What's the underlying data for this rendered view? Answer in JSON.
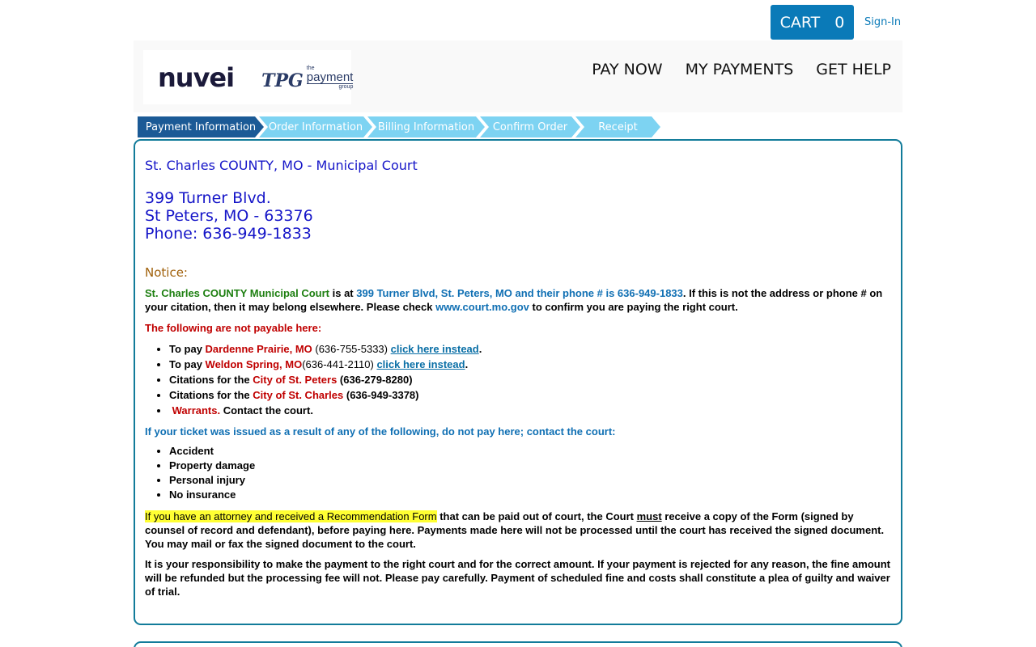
{
  "topbar": {
    "cart_label": "CART",
    "cart_count": "0",
    "signin_label": "Sign-In"
  },
  "header": {
    "logo_nuvei": "nuvei",
    "logo_tpg_mark": "TPG",
    "logo_tpg_small": "the",
    "logo_tpg_big": "payment",
    "logo_tpg_group": "group",
    "nav": [
      "PAY NOW",
      "MY PAYMENTS",
      "GET HELP"
    ]
  },
  "steps": [
    {
      "label": "Payment Information",
      "state": "active"
    },
    {
      "label": "Order Information",
      "state": "inactive"
    },
    {
      "label": "Billing Information",
      "state": "inactive"
    },
    {
      "label": "Confirm Order",
      "state": "inactive"
    },
    {
      "label": "Receipt",
      "state": "inactive"
    }
  ],
  "main": {
    "court_name": "St. Charles COUNTY, MO - Municipal Court",
    "address_line1": "399 Turner Blvd.",
    "address_line2": "St Peters, MO - 63376",
    "address_line3": "Phone: 636-949-1833",
    "notice_label": "Notice:",
    "notice": {
      "court": "St. Charles COUNTY Municipal Court",
      "is_at": " is at ",
      "addr": "399 Turner Blvd, St. Peters, MO and their phone # is 636-949-1833",
      "rest": ". If this is not the address or phone # on your citation, then it may belong elsewhere. Please check ",
      "site": "www.court.mo.gov",
      "end": " to confirm you are paying the right court."
    },
    "not_payable_heading": "The following are not payable here:",
    "not_payable": {
      "item1_prefix": "To pay ",
      "item1_place": "Dardenne Prairie, MO",
      "item1_phone": " (636-755-5333) ",
      "item1_link": "click here instead",
      "item2_prefix": "To pay ",
      "item2_place": "Weldon Spring, MO",
      "item2_phone": "(636-441-2110) ",
      "item2_link": "click here instead",
      "item3_prefix": "Citations for the ",
      "item3_place": "City of St. Peters",
      "item3_phone": " (636-279-8280)",
      "item4_prefix": "Citations for the ",
      "item4_place": "City of St. Charles",
      "item4_phone": " (636-949-3378)",
      "item5_place": " Warrants.",
      "item5_rest": " Contact the court."
    },
    "contact_heading": "If your ticket was issued as a result of any of the following, do not pay here; contact the court:",
    "contact_items": [
      "Accident",
      "Property damage",
      "Personal injury",
      "No insurance"
    ],
    "attorney": {
      "highlight": "If you have an attorney and received a Recommendation Form",
      "part1": " that can be paid out of court, the Court ",
      "must": "must",
      "part2": " receive a copy of the Form (signed by counsel of record and defendant), before paying here. Payments made here will not be processed until the court has received the signed document. You may mail or fax the signed document to the court."
    },
    "responsibility": "It is your responsibility to make the payment to the right court and for the correct amount. If your payment is rejected for any reason, the fine amount will be refunded but the processing fee will not. Please pay carefully. Payment of scheduled fine and costs shall constitute a plea of guilty and waiver of trial."
  }
}
